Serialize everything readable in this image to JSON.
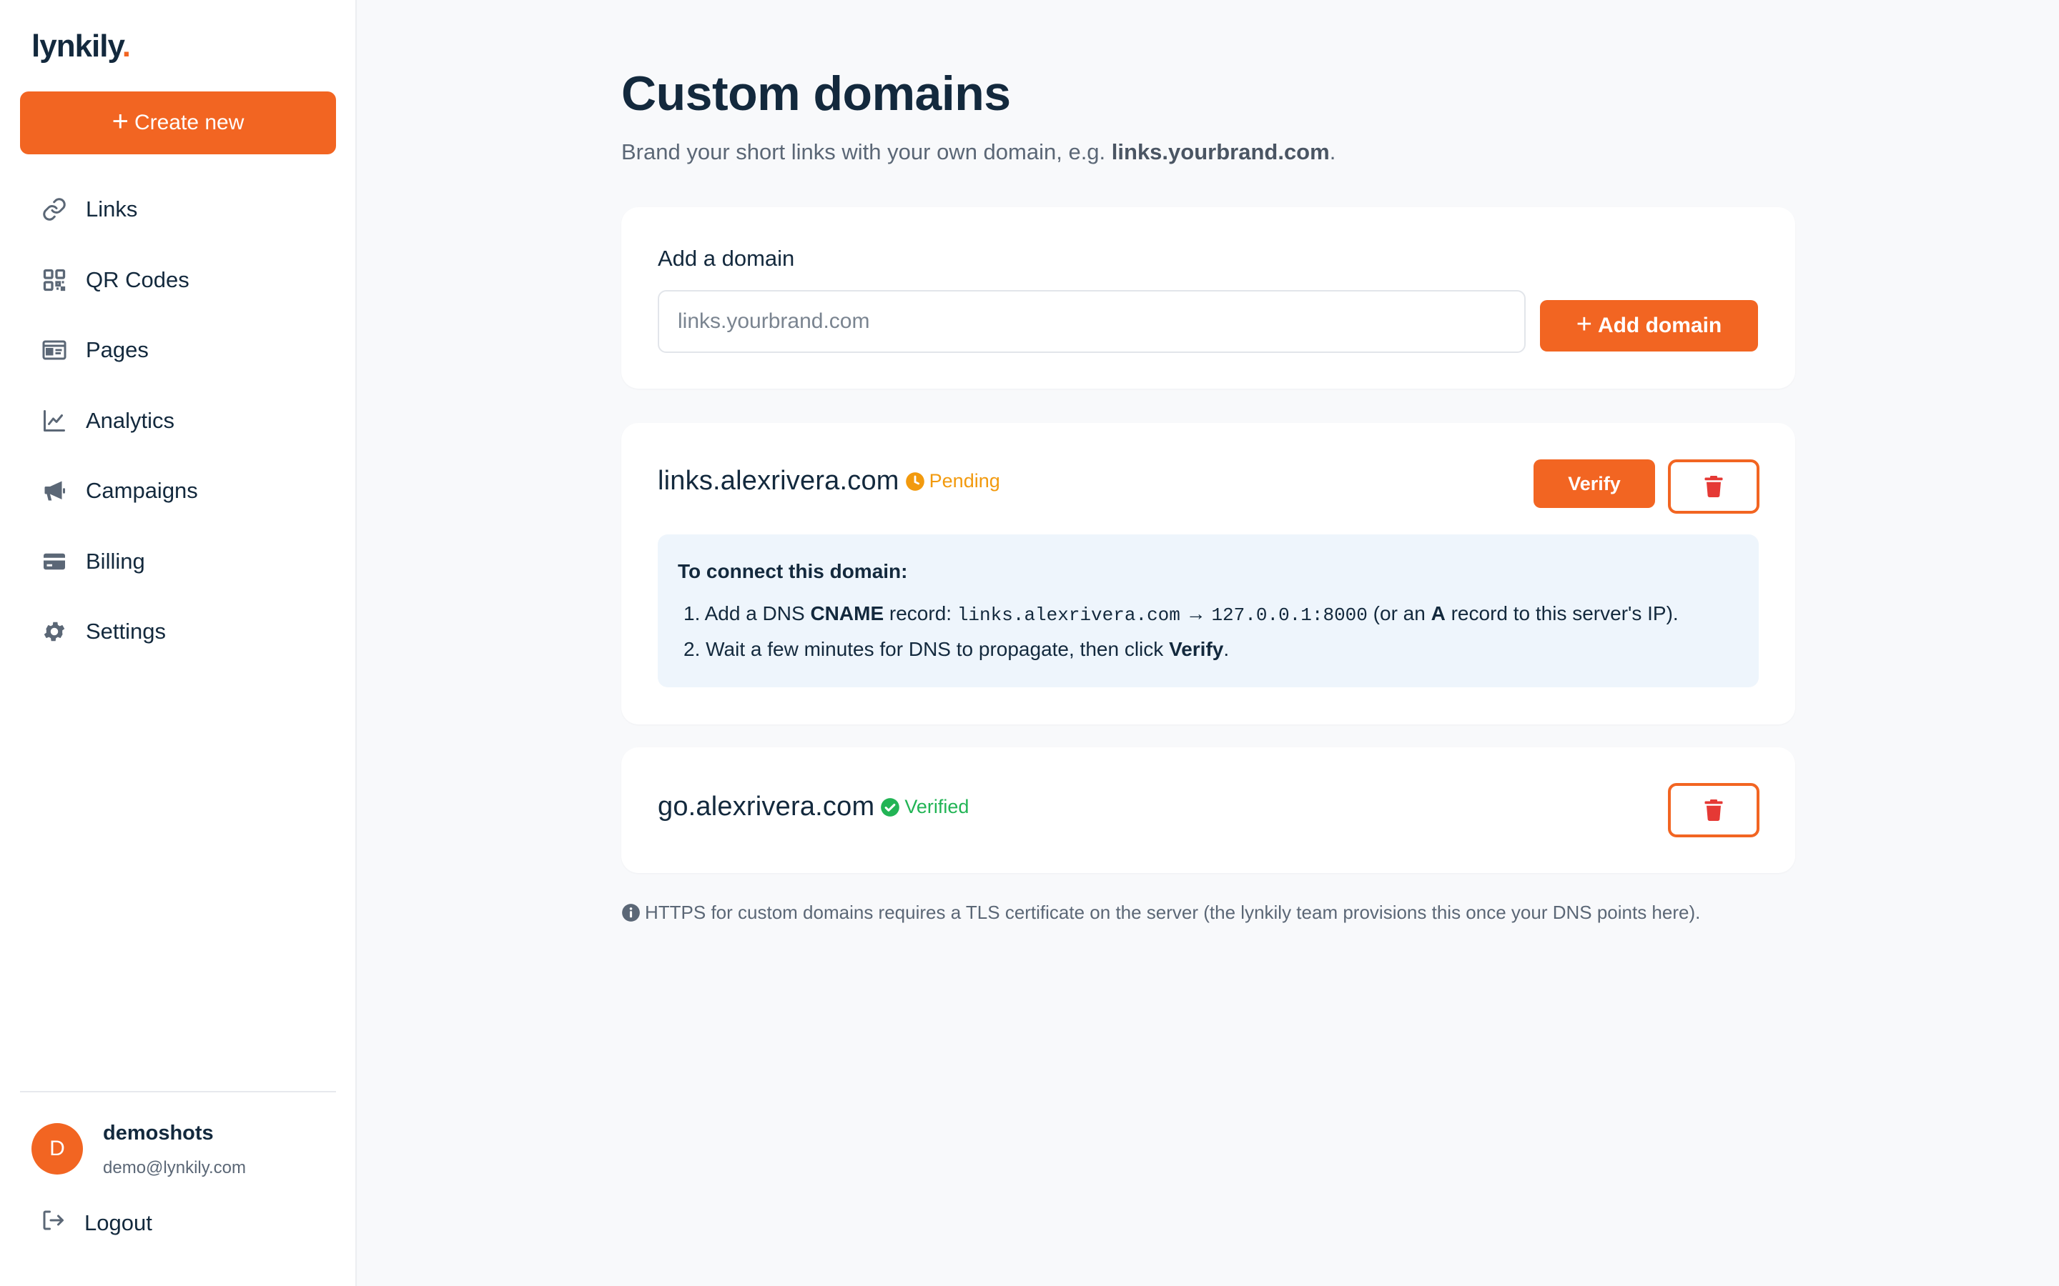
{
  "sidebar": {
    "logo_text": "lynkily",
    "logo_dot": ".",
    "create_label": "Create new",
    "nav": [
      {
        "label": "Links",
        "icon": "link-icon"
      },
      {
        "label": "QR Codes",
        "icon": "qr-code-icon"
      },
      {
        "label": "Pages",
        "icon": "id-card-icon"
      },
      {
        "label": "Analytics",
        "icon": "chart-line-icon"
      },
      {
        "label": "Campaigns",
        "icon": "megaphone-icon"
      },
      {
        "label": "Billing",
        "icon": "credit-card-icon"
      },
      {
        "label": "Settings",
        "icon": "gear-icon"
      }
    ],
    "user": {
      "initial": "D",
      "name": "demoshots",
      "email": "demo@lynkily.com"
    },
    "logout_label": "Logout"
  },
  "main": {
    "title": "Custom domains",
    "subtitle_prefix": "Brand your short links with your own domain, e.g. ",
    "subtitle_example": "links.yourbrand.com",
    "subtitle_suffix": ".",
    "add_domain": {
      "label": "Add a domain",
      "placeholder": "links.yourbrand.com",
      "value": "",
      "button_label": "Add domain"
    },
    "domains": [
      {
        "name": "links.alexrivera.com",
        "status": "Pending",
        "verify_label": "Verify",
        "instructions": {
          "title": "To connect this domain:",
          "step1_num": "1.",
          "step1_a": "Add a DNS ",
          "step1_b": "CNAME",
          "step1_c": " record: ",
          "step1_host": "links.alexrivera.com",
          "step1_arrow": "→",
          "step1_target": "127.0.0.1:8000",
          "step1_d": " (or an ",
          "step1_e": "A",
          "step1_f": " record to this server's IP).",
          "step2_num": "2.",
          "step2_a": "Wait a few minutes for DNS to propagate, then click ",
          "step2_b": "Verify",
          "step2_c": "."
        }
      },
      {
        "name": "go.alexrivera.com",
        "status": "Verified"
      }
    ],
    "note": "HTTPS for custom domains requires a TLS certificate on the server (the lynkily team provisions this once your DNS points here)."
  },
  "colors": {
    "accent": "#f26522",
    "pending": "#f29a0e",
    "verified": "#22b455",
    "text": "#13293d",
    "muted": "#5b6776",
    "instructions_bg": "#eef5fc",
    "trash": "#e53935"
  }
}
